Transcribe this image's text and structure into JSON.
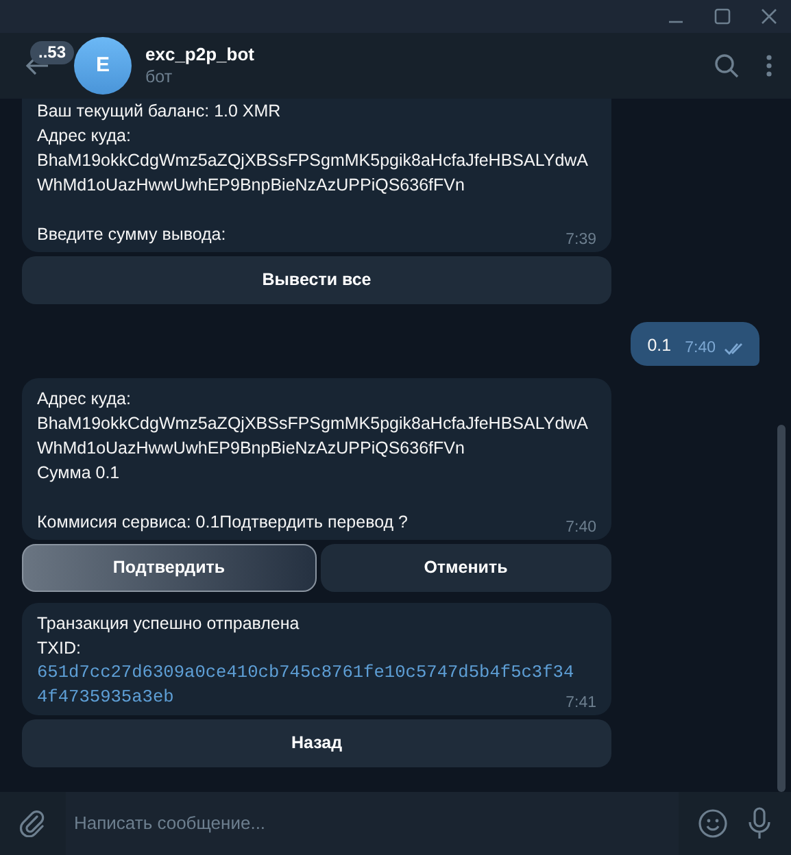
{
  "header": {
    "unread_badge": "..53",
    "avatar_letter": "E",
    "title": "exc_p2p_bot",
    "subtitle": "бот"
  },
  "messages": [
    {
      "kind": "incoming",
      "paragraphs": [
        [
          {
            "kind": "text",
            "text": "Ваш текущий баланс: 1.0 XMR"
          },
          {
            "kind": "text",
            "text": "Адрес куда:"
          },
          {
            "kind": "text",
            "text": "BhaM19okkCdgWmz5aZQjXBSsFPSgmMK5pgik8aHcfaJfeHBSALYdwA"
          },
          {
            "kind": "text",
            "text": "WhMd1oUazHwwUwhEP9BnpBieNzAzUPPiQS636fFVn"
          }
        ],
        [
          {
            "kind": "text",
            "text": "Введите сумму вывода:"
          }
        ]
      ],
      "time": "7:39",
      "keyboard": [
        [
          {
            "label": "Вывести все",
            "pressed": false
          }
        ]
      ]
    },
    {
      "kind": "outgoing",
      "text": "0.1",
      "time": "7:40",
      "read": true
    },
    {
      "kind": "incoming",
      "paragraphs": [
        [
          {
            "kind": "text",
            "text": "Адрес куда:"
          },
          {
            "kind": "text",
            "text": "BhaM19okkCdgWmz5aZQjXBSsFPSgmMK5pgik8aHcfaJfeHBSALYdwA"
          },
          {
            "kind": "text",
            "text": "WhMd1oUazHwwUwhEP9BnpBieNzAzUPPiQS636fFVn"
          },
          {
            "kind": "text",
            "text": "Сумма 0.1"
          }
        ],
        [
          {
            "kind": "text",
            "text": "Коммисия сервиса: 0.1Подтвердить перевод ?"
          }
        ]
      ],
      "time": "7:40",
      "keyboard": [
        [
          {
            "label": "Подтвердить",
            "pressed": true
          },
          {
            "label": "Отменить",
            "pressed": false
          }
        ]
      ]
    },
    {
      "kind": "incoming",
      "paragraphs": [
        [
          {
            "kind": "text",
            "text": "Транзакция успешно отправлена"
          },
          {
            "kind": "text",
            "text": "TXID:"
          },
          {
            "kind": "code",
            "text": "651d7cc27d6309a0ce410cb745c8761fe10c5747d5b4f5c3f34"
          },
          {
            "kind": "code",
            "text": "4f4735935a3eb"
          }
        ]
      ],
      "time": "7:41",
      "keyboard": [
        [
          {
            "label": "Назад",
            "pressed": false
          }
        ]
      ]
    }
  ],
  "composer": {
    "placeholder": "Написать сообщение..."
  }
}
